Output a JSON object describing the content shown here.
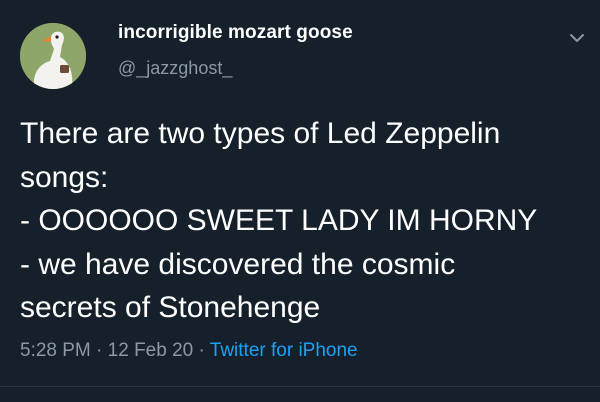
{
  "user": {
    "display_name": "incorrigible mozart goose",
    "handle": "@_jazzghost_",
    "avatar_icon": "goose-avatar",
    "avatar_bg": "#8fa66a"
  },
  "tweet": {
    "lines": [
      "There are two types of Led Zeppelin",
      "songs:",
      "- OOOOOO SWEET LADY IM HORNY",
      "- we have discovered the cosmic",
      "secrets of Stonehenge"
    ]
  },
  "meta": {
    "time": "5:28 PM",
    "separator": " · ",
    "date": "12 Feb 20",
    "source": "Twitter for iPhone"
  },
  "icons": {
    "caret": "chevron-down-icon"
  },
  "colors": {
    "background": "#15202b",
    "text": "#ffffff",
    "secondary": "#8b98a5",
    "link": "#1da1f2"
  }
}
